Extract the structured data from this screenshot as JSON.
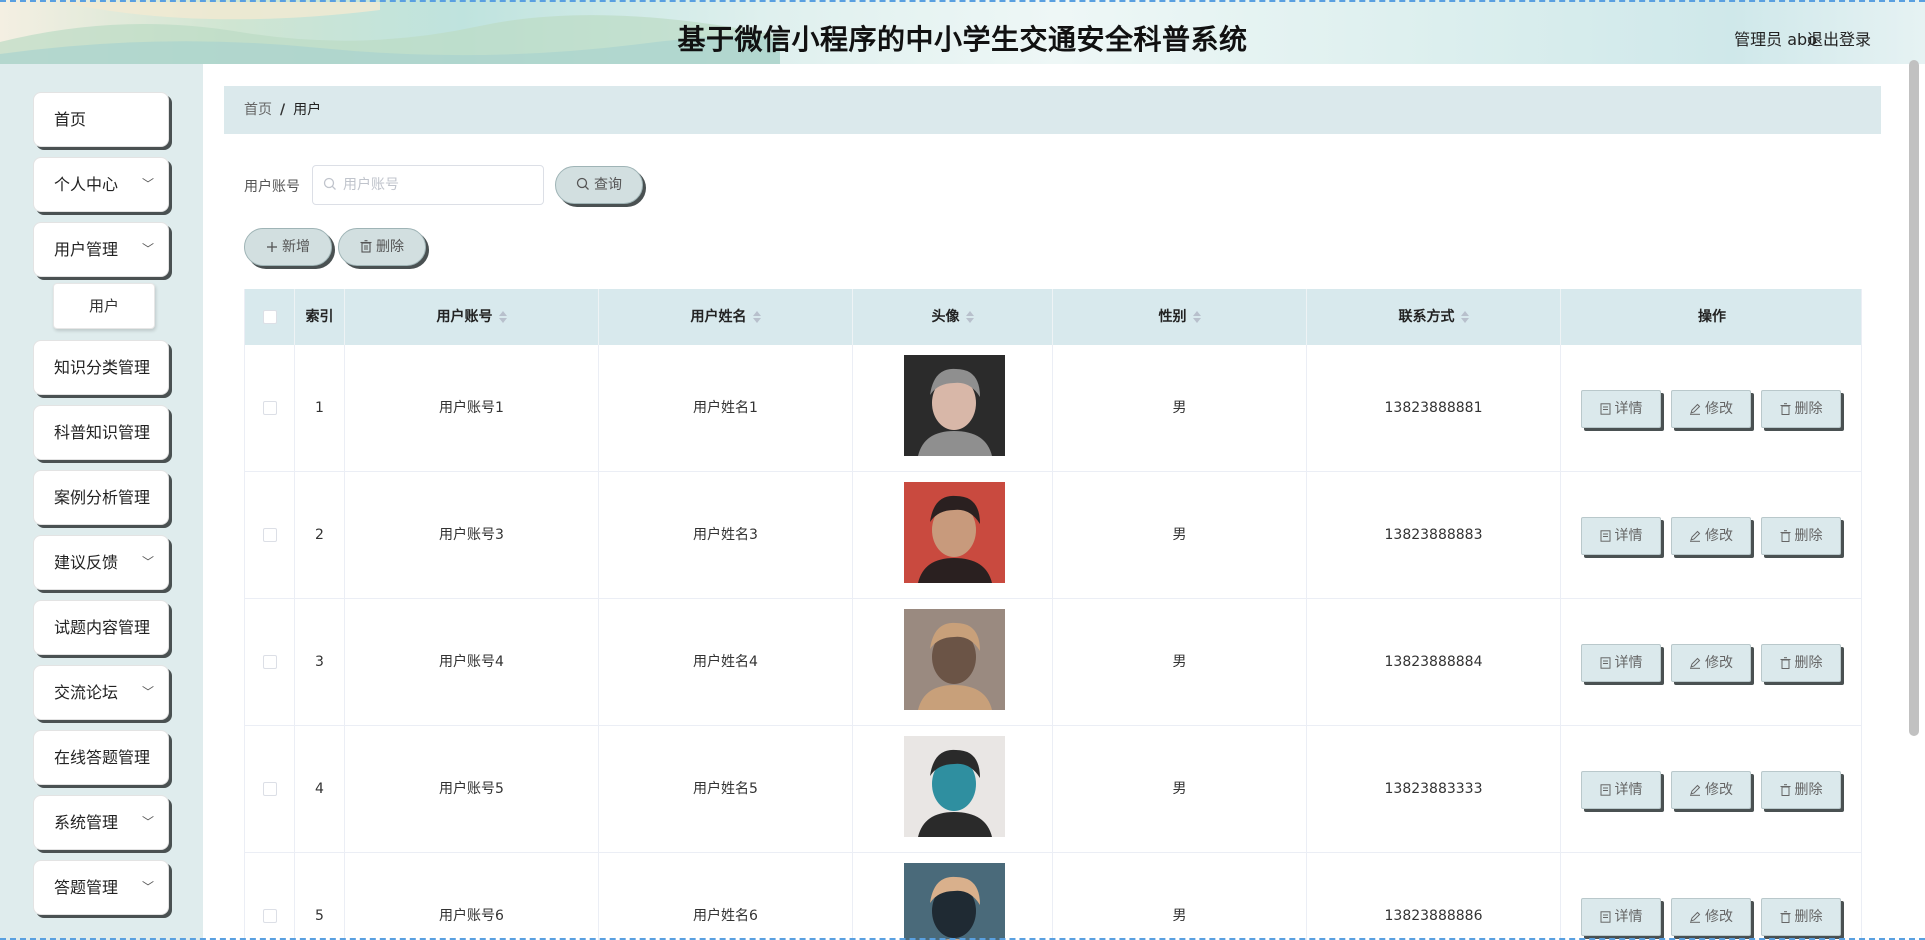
{
  "header": {
    "title": "基于微信小程序的中小学生交通安全科普系统",
    "user_label": "管理员 abo",
    "logout_label": "退出登录"
  },
  "sidebar": {
    "items": [
      {
        "label": "首页",
        "has_children": false
      },
      {
        "label": "个人中心",
        "has_children": true
      },
      {
        "label": "用户管理",
        "has_children": true
      },
      {
        "label": "知识分类管理",
        "has_children": false
      },
      {
        "label": "科普知识管理",
        "has_children": false
      },
      {
        "label": "案例分析管理",
        "has_children": false
      },
      {
        "label": "建议反馈",
        "has_children": true
      },
      {
        "label": "试题内容管理",
        "has_children": false
      },
      {
        "label": "交流论坛",
        "has_children": true
      },
      {
        "label": "在线答题管理",
        "has_children": false
      },
      {
        "label": "系统管理",
        "has_children": true
      },
      {
        "label": "答题管理",
        "has_children": true
      }
    ],
    "subitem": "用户"
  },
  "breadcrumb": {
    "home": "首页",
    "separator": "/",
    "current": "用户"
  },
  "search": {
    "label": "用户账号",
    "placeholder": "用户账号",
    "value": "",
    "button_label": "查询"
  },
  "toolbar": {
    "add_label": "新增",
    "delete_label": "删除"
  },
  "table": {
    "columns": {
      "index": "索引",
      "account": "用户账号",
      "name": "用户姓名",
      "avatar": "头像",
      "gender": "性别",
      "phone": "联系方式",
      "actions": "操作"
    },
    "action_labels": {
      "detail": "详情",
      "edit": "修改",
      "delete": "删除"
    },
    "rows": [
      {
        "index": "1",
        "account": "用户账号1",
        "name": "用户姓名1",
        "gender": "男",
        "phone": "13823888881"
      },
      {
        "index": "2",
        "account": "用户账号3",
        "name": "用户姓名3",
        "gender": "男",
        "phone": "13823888883"
      },
      {
        "index": "3",
        "account": "用户账号4",
        "name": "用户姓名4",
        "gender": "男",
        "phone": "13823888884"
      },
      {
        "index": "4",
        "account": "用户账号5",
        "name": "用户姓名5",
        "gender": "男",
        "phone": "13823883333"
      },
      {
        "index": "5",
        "account": "用户账号6",
        "name": "用户姓名6",
        "gender": "男",
        "phone": "13823888886"
      }
    ]
  },
  "colors": {
    "accent": "#dbe9ec",
    "sidebar_bg": "#dfeced",
    "button_shadow": "#4a5152"
  }
}
